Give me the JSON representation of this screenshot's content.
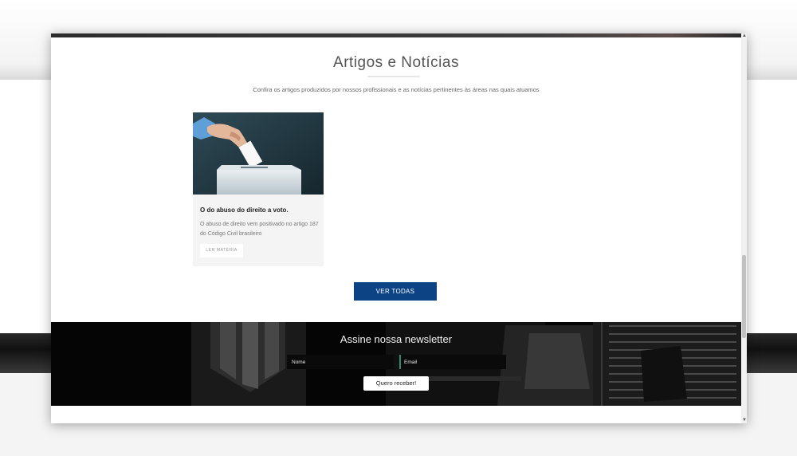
{
  "articles_section": {
    "title": "Artigos e Notícias",
    "subtitle": "Confira os artigos produzidos por nossos profissionais e as notícias pertinentes às áreas nas quais atuamos",
    "articles": [
      {
        "title": "O do abuso do direito a voto.",
        "excerpt": "O abuso de direito vem positivado no artigo 187 do Código Civil brasileiro",
        "button_label": "LER MATÉRIA",
        "image_icon": "ballot-box-image"
      }
    ],
    "view_all_label": "VER TODAS"
  },
  "newsletter": {
    "title": "Assine nossa newsletter",
    "name_placeholder": "Nome",
    "email_placeholder": "Email",
    "submit_label": "Quero receber!"
  },
  "colors": {
    "accent_blue": "#0c4384",
    "newsletter_bg": "#000000",
    "card_bg": "#f4f4f4"
  }
}
